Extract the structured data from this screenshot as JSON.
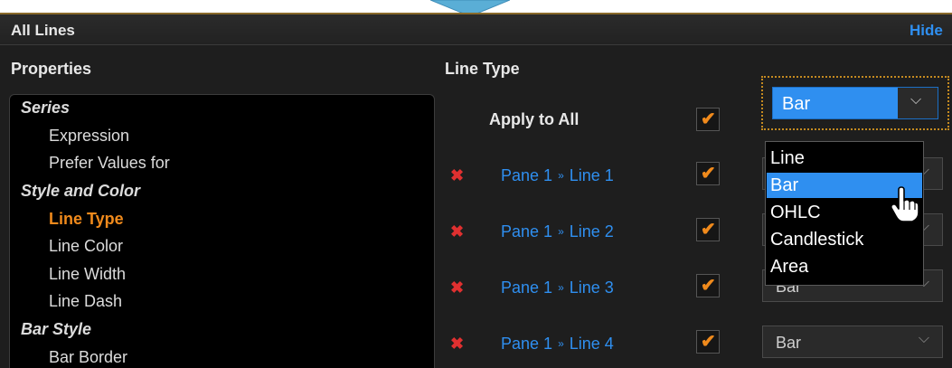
{
  "header": {
    "title": "All Lines",
    "hide_label": "Hide"
  },
  "properties": {
    "heading": "Properties",
    "items": [
      {
        "label": "Series",
        "kind": "category"
      },
      {
        "label": "Expression",
        "kind": "sub"
      },
      {
        "label": "Prefer Values for",
        "kind": "sub"
      },
      {
        "label": "Style and Color",
        "kind": "category"
      },
      {
        "label": "Line Type",
        "kind": "sub",
        "active": true
      },
      {
        "label": "Line Color",
        "kind": "sub"
      },
      {
        "label": "Line Width",
        "kind": "sub"
      },
      {
        "label": "Line Dash",
        "kind": "sub"
      },
      {
        "label": "Bar Style",
        "kind": "category"
      },
      {
        "label": "Bar Border",
        "kind": "sub"
      }
    ]
  },
  "line_type": {
    "heading": "Line Type",
    "apply_all": {
      "label": "Apply to All",
      "checked": true,
      "value": "Bar"
    },
    "separator": "»",
    "rows": [
      {
        "pane": "Pane 1",
        "line": "Line 1",
        "checked": true,
        "value": ""
      },
      {
        "pane": "Pane 1",
        "line": "Line 2",
        "checked": true,
        "value": ""
      },
      {
        "pane": "Pane 1",
        "line": "Line 3",
        "checked": true,
        "value": "Bar"
      },
      {
        "pane": "Pane 1",
        "line": "Line 4",
        "checked": true,
        "value": "Bar"
      }
    ],
    "options": [
      "Line",
      "Bar",
      "OHLC",
      "Candlestick",
      "Area"
    ],
    "highlighted_option": "Bar"
  },
  "icons": {
    "remove": "✖",
    "check": "✔",
    "chevron": "⌵"
  },
  "colors": {
    "accent_blue": "#2f8ff0",
    "accent_orange": "#f08a1c",
    "remove_red": "#e03030"
  }
}
